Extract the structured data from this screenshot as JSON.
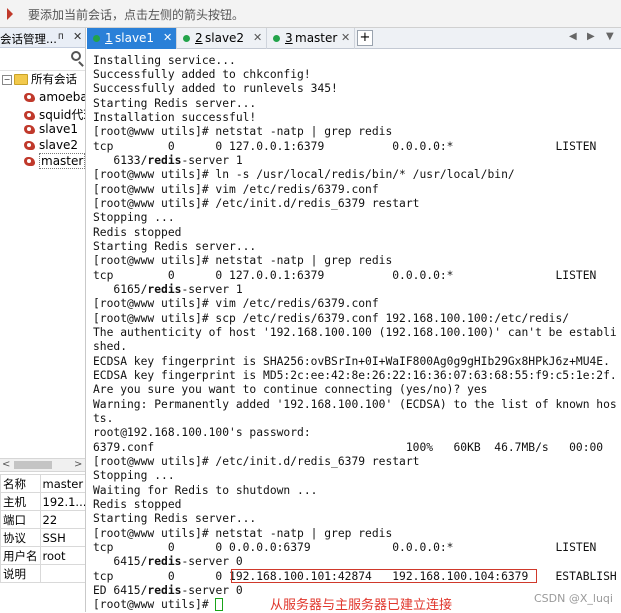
{
  "hint_bar": {
    "text": "要添加当前会话，点击左侧的箭头按钮。"
  },
  "session_panel": {
    "title": "会话管理...",
    "pin": "ᴨ",
    "close": "✕",
    "root": {
      "toggle": "−",
      "label": "所有会话"
    },
    "items": [
      {
        "label": "amoeba"
      },
      {
        "label": "squid代理"
      },
      {
        "label": "slave1"
      },
      {
        "label": "slave2"
      },
      {
        "label": "master"
      }
    ],
    "scroll_left": "<",
    "scroll_right": ">"
  },
  "properties": [
    {
      "key": "名称",
      "value": "master"
    },
    {
      "key": "主机",
      "value": "192.1..."
    },
    {
      "key": "端口",
      "value": "22"
    },
    {
      "key": "协议",
      "value": "SSH"
    },
    {
      "key": "用户名",
      "value": "root"
    },
    {
      "key": "说明",
      "value": ""
    }
  ],
  "tabs": [
    {
      "num": "1",
      "name": " slave1",
      "close": "✕"
    },
    {
      "num": "2",
      "name": " slave2",
      "close": "✕"
    },
    {
      "num": "3",
      "name": " master",
      "close": "✕"
    }
  ],
  "tab_add": "+",
  "tab_prev": "◀",
  "tab_next": "▶",
  "tab_menu": "▼",
  "terminal_lines": [
    [
      "Installing service..."
    ],
    [
      "Successfully added to chkconfig!"
    ],
    [
      "Successfully added to runlevels 345!"
    ],
    [
      "Starting Redis server..."
    ],
    [
      "Installation successful!"
    ],
    [
      "[root@www utils]# netstat -natp | grep redis"
    ],
    [
      "tcp        0      0 127.0.0.1:6379          0.0.0.0:*               LISTEN"
    ],
    [
      "   6133/",
      "redis",
      "-server 1"
    ],
    [
      "[root@www utils]# ln -s /usr/local/redis/bin/* /usr/local/bin/"
    ],
    [
      "[root@www utils]# vim /etc/redis/6379.conf"
    ],
    [
      "[root@www utils]# /etc/init.d/redis_6379 restart"
    ],
    [
      "Stopping ..."
    ],
    [
      "Redis stopped"
    ],
    [
      "Starting Redis server..."
    ],
    [
      "[root@www utils]# netstat -natp | grep redis"
    ],
    [
      "tcp        0      0 127.0.0.1:6379          0.0.0.0:*               LISTEN"
    ],
    [
      "   6165/",
      "redis",
      "-server 1"
    ],
    [
      "[root@www utils]# vim /etc/redis/6379.conf"
    ],
    [
      "[root@www utils]# scp /etc/redis/6379.conf 192.168.100.100:/etc/redis/"
    ],
    [
      "The authenticity of host '192.168.100.100 (192.168.100.100)' can't be establi"
    ],
    [
      "shed."
    ],
    [
      "ECDSA key fingerprint is SHA256:ovBSrIn+0I+WaIF800Ag0g9gHIb29Gx8HPkJ6z+MU4E."
    ],
    [
      "ECDSA key fingerprint is MD5:2c:ee:42:8e:26:22:16:36:07:63:68:55:f9:c5:1e:2f."
    ],
    [
      "Are you sure you want to continue connecting (yes/no)? yes"
    ],
    [
      "Warning: Permanently added '192.168.100.100' (ECDSA) to the list of known hos"
    ],
    [
      "ts."
    ],
    [
      "root@192.168.100.100's password:"
    ],
    [
      "6379.conf                                     100%   60KB  46.7MB/s   00:00"
    ],
    [
      "[root@www utils]# /etc/init.d/redis_6379 restart"
    ],
    [
      "Stopping ..."
    ],
    [
      "Waiting for Redis to shutdown ..."
    ],
    [
      "Redis stopped"
    ],
    [
      "Starting Redis server..."
    ],
    [
      "[root@www utils]# netstat -natp | grep redis"
    ],
    [
      "tcp        0      0 0.0.0.0:6379            0.0.0.0:*               LISTEN"
    ],
    [
      "   6415/",
      "redis",
      "-server 0"
    ],
    [
      "tcp        0      0 192.168.100.101:42874   192.168.100.104:6379    ESTABLISH"
    ],
    [
      "ED 6415/",
      "redis",
      "-server 0"
    ],
    [
      "[root@www utils]# "
    ]
  ],
  "annotation": "从服务器与主服务器已建立连接",
  "watermark": "CSDN @X_luqi",
  "colors": {
    "active_tab": "#2a80d8",
    "status_dot": "#22a34a",
    "annotation": "#e0352b",
    "cursor": "#19a319"
  }
}
